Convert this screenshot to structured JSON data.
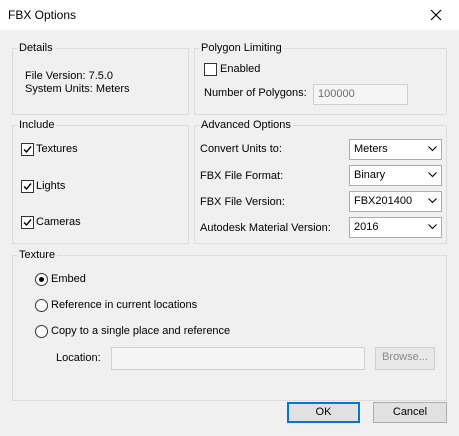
{
  "window": {
    "title": "FBX Options"
  },
  "details": {
    "legend": "Details",
    "file_version": "File Version: 7.5.0",
    "system_units": "System Units: Meters"
  },
  "polygon_limiting": {
    "legend": "Polygon Limiting",
    "enabled_label": "Enabled",
    "enabled_checked": false,
    "num_polygons_label": "Number of Polygons:",
    "num_polygons_value": "100000"
  },
  "include": {
    "legend": "Include",
    "items": [
      {
        "label": "Textures",
        "checked": true
      },
      {
        "label": "Lights",
        "checked": true
      },
      {
        "label": "Cameras",
        "checked": true
      }
    ]
  },
  "advanced": {
    "legend": "Advanced Options",
    "rows": [
      {
        "label": "Convert Units to:",
        "value": "Meters"
      },
      {
        "label": "FBX File Format:",
        "value": "Binary"
      },
      {
        "label": "FBX File Version:",
        "value": "FBX201400"
      },
      {
        "label": "Autodesk Material Version:",
        "value": "2016"
      }
    ]
  },
  "texture": {
    "legend": "Texture",
    "options": [
      {
        "label": "Embed",
        "selected": true
      },
      {
        "label": "Reference in current locations",
        "selected": false
      },
      {
        "label": "Copy to a single place and reference",
        "selected": false
      }
    ],
    "location_label": "Location:",
    "location_value": "",
    "browse_label": "Browse..."
  },
  "buttons": {
    "ok": "OK",
    "cancel": "Cancel"
  },
  "icons": {
    "close": "close-icon",
    "check": "check-icon",
    "dropdown": "chevron-down-icon"
  }
}
